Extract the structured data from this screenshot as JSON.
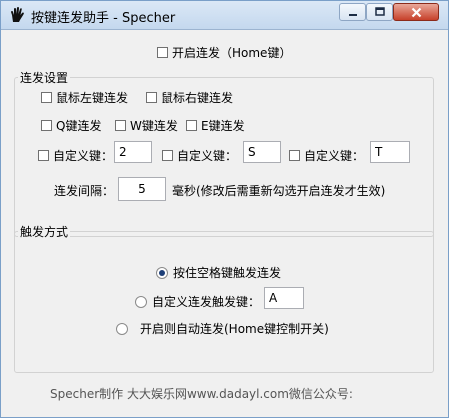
{
  "window": {
    "title": "按键连发助手 - Specher"
  },
  "enable_checkbox": {
    "label": "开启连发（Home键）",
    "checked": false
  },
  "group_settings": {
    "title": "连发设置",
    "mouse_left": {
      "label": "鼠标左键连发",
      "checked": false
    },
    "mouse_right": {
      "label": "鼠标右键连发",
      "checked": false
    },
    "q_key": {
      "label": "Q键连发",
      "checked": false
    },
    "w_key": {
      "label": "W键连发",
      "checked": false
    },
    "e_key": {
      "label": "E键连发",
      "checked": false
    },
    "custom1": {
      "label": "自定义键：",
      "value": "2",
      "checked": false
    },
    "custom2": {
      "label": "自定义键：",
      "value": "S",
      "checked": false
    },
    "custom3": {
      "label": "自定义键：",
      "value": "T",
      "checked": false
    },
    "interval": {
      "label": "连发间隔：",
      "value": "5",
      "unit_note": "毫秒(修改后需重新勾选开启连发才生效)"
    }
  },
  "group_trigger": {
    "title": "触发方式",
    "hold_space": {
      "label": "按住空格键触发连发",
      "selected": true
    },
    "custom_trigger": {
      "label": "自定义连发触发键：",
      "value": "A",
      "selected": false
    },
    "auto_start": {
      "label": "开启则自动连发(Home键控制开关)",
      "selected": false
    }
  },
  "footer": {
    "text": "Specher制作 大大娱乐网www.dadayl.com微信公众号:"
  }
}
